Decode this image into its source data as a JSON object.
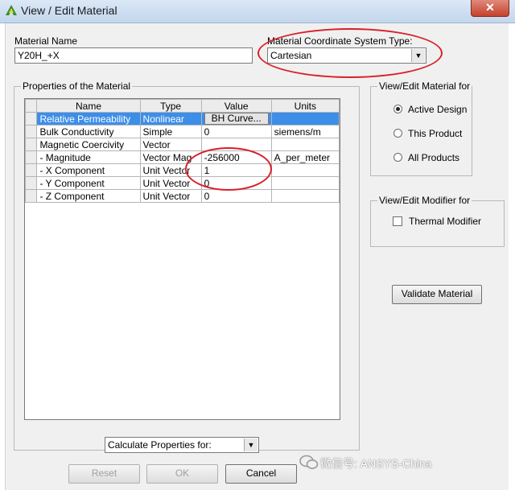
{
  "window": {
    "title": "View / Edit Material",
    "close_glyph": "✕",
    "icon": "ansys-logo-icon"
  },
  "material_name": {
    "label": "Material Name",
    "value": "Y20H_+X"
  },
  "coordinate_system": {
    "label": "Material Coordinate System Type:",
    "selected": "Cartesian"
  },
  "properties_group": {
    "title": "Properties of the Material",
    "columns": [
      "Name",
      "Type",
      "Value",
      "Units"
    ],
    "rows": [
      {
        "name": "Relative Permeability",
        "type": "Nonlinear",
        "value": "BH Curve...",
        "units": "",
        "selected": true
      },
      {
        "name": "Bulk Conductivity",
        "type": "Simple",
        "value": "0",
        "units": "siemens/m"
      },
      {
        "name": "Magnetic Coercivity",
        "type": "Vector",
        "value": "",
        "units": ""
      },
      {
        "name": "- Magnitude",
        "type": "Vector Mag",
        "value": "-256000",
        "units": "A_per_meter"
      },
      {
        "name": "- X Component",
        "type": "Unit Vector",
        "value": "1",
        "units": ""
      },
      {
        "name": "- Y Component",
        "type": "Unit Vector",
        "value": "0",
        "units": ""
      },
      {
        "name": "- Z Component",
        "type": "Unit Vector",
        "value": "0",
        "units": ""
      }
    ]
  },
  "view_edit_for": {
    "title": "View/Edit Material for",
    "options": [
      "Active Design",
      "This Product",
      "All Products"
    ],
    "selected": "Active Design"
  },
  "modifier_group": {
    "title": "View/Edit Modifier for",
    "checkbox_label": "Thermal Modifier",
    "checked": false
  },
  "buttons": {
    "validate": "Validate Material",
    "reset": "Reset",
    "ok": "OK",
    "cancel": "Cancel"
  },
  "calculate": {
    "selected": "Calculate Properties for:"
  },
  "watermark": {
    "text": "微信号: ANSYS-China"
  },
  "colors": {
    "selection": "#3d8ee8",
    "annotation": "#d9202a",
    "dialog_bg": "#f0f0f0"
  }
}
